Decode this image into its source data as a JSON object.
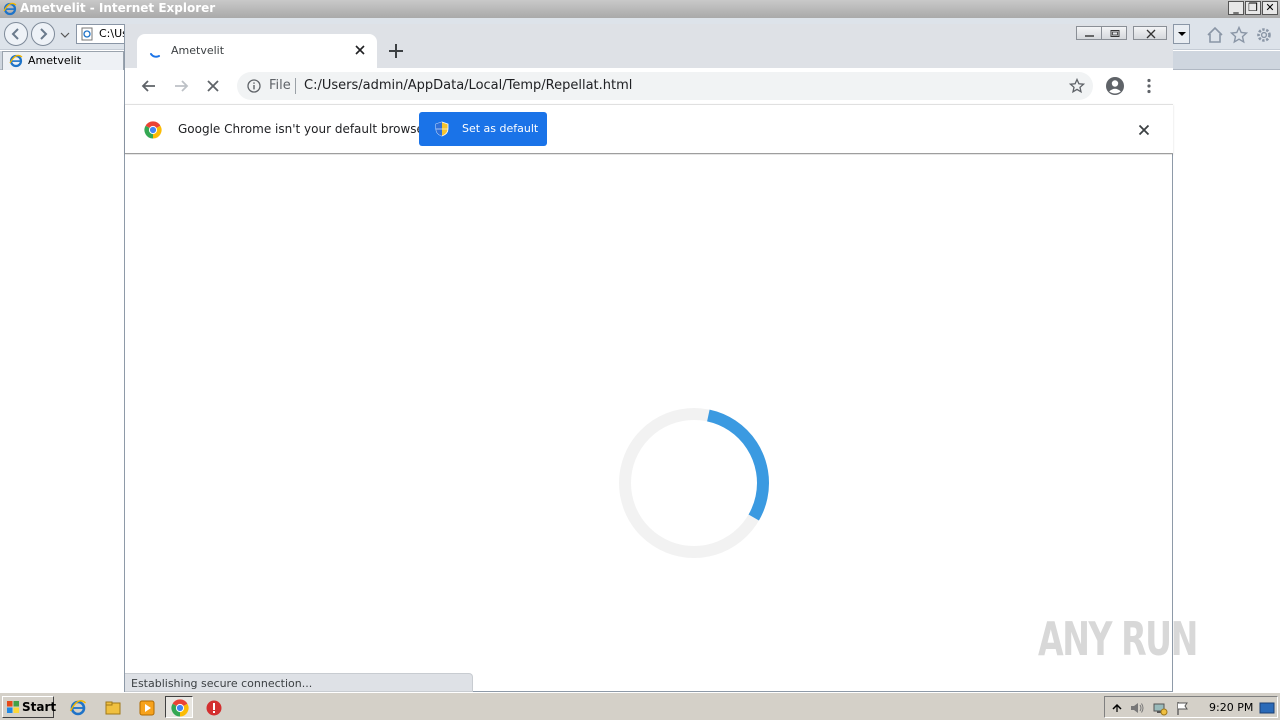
{
  "ie": {
    "title": "Ametvelit - Internet Explorer",
    "address": "C:\\Us",
    "tab_label": "Ametvelit",
    "caption_minimize": "_",
    "caption_restore": "❐",
    "caption_close": "✕"
  },
  "chrome": {
    "tab_title": "Ametvelit",
    "omnibox": {
      "scheme": "File",
      "url": "C:/Users/admin/AppData/Local/Temp/Repellat.html"
    },
    "infobar": {
      "message": "Google Chrome isn't your default browser",
      "button_label": "Set as default"
    },
    "status": "Establishing secure connection...",
    "loader_progress": 0.3
  },
  "watermark": "ANY RUN",
  "taskbar": {
    "start_label": "Start",
    "clock": "9:20 PM"
  },
  "colors": {
    "accent": "#1a73e8",
    "loader": "#3b9ae1",
    "loader_track": "#f2f2f2",
    "chrome_frame": "#dee1e6"
  },
  "icons": {
    "ie_logo": "ie-logo-icon",
    "back": "arrow-left-icon",
    "forward": "arrow-right-icon",
    "stop": "close-icon",
    "info": "info-icon",
    "star": "star-icon",
    "account": "account-circle-icon",
    "menu": "vertical-dots-icon",
    "shield": "uac-shield-icon"
  }
}
